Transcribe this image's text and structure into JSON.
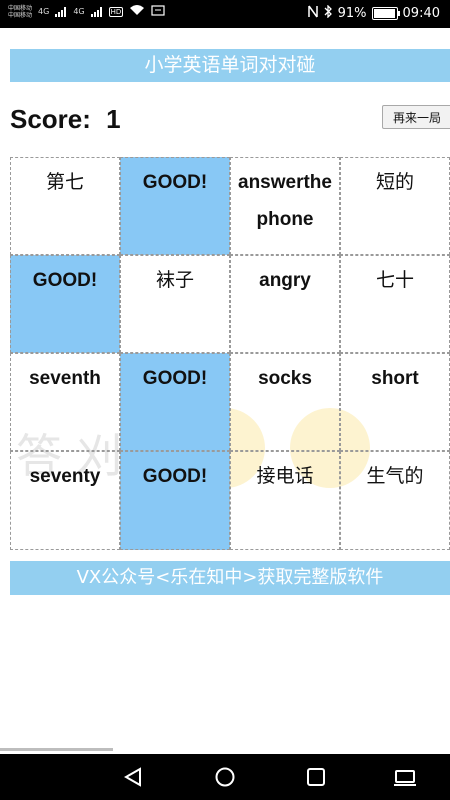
{
  "status_bar": {
    "carrier1": "中国移动",
    "carrier2": "中国移动",
    "signal1": "4G",
    "signal2": "4G",
    "hd": "HD",
    "battery": "91%",
    "time": "09:40"
  },
  "app": {
    "title": "小学英语单词对对碰",
    "score_label": "Score:",
    "score_value": "1",
    "restart_label": "再来一局",
    "footer": "VX公众号<乐在知中>获取完整版软件"
  },
  "grid": {
    "cells": [
      {
        "text": "第七",
        "state": "word"
      },
      {
        "text": "GOOD!",
        "state": "good"
      },
      {
        "text": "answerthephone",
        "state": "word"
      },
      {
        "text": "短的",
        "state": "word"
      },
      {
        "text": "GOOD!",
        "state": "good"
      },
      {
        "text": "袜子",
        "state": "word"
      },
      {
        "text": "angry",
        "state": "word"
      },
      {
        "text": "七十",
        "state": "word"
      },
      {
        "text": "seventh",
        "state": "word"
      },
      {
        "text": "GOOD!",
        "state": "good"
      },
      {
        "text": "socks",
        "state": "word"
      },
      {
        "text": "short",
        "state": "word"
      },
      {
        "text": "seventy",
        "state": "word"
      },
      {
        "text": "GOOD!",
        "state": "good"
      },
      {
        "text": "接电话",
        "state": "word"
      },
      {
        "text": "生气的",
        "state": "word"
      }
    ]
  },
  "watermark_text": "答 刈",
  "colors": {
    "banner": "#93cff0",
    "good_cell": "#88c8f5"
  },
  "nav_icons": [
    "back-icon",
    "home-icon",
    "recent-apps-icon",
    "keyboard-icon"
  ]
}
